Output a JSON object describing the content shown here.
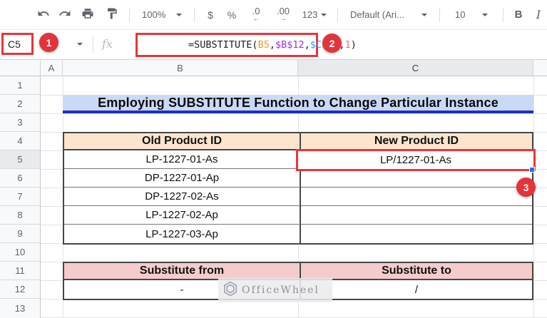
{
  "toolbar": {
    "zoom": "100%",
    "currency": "$",
    "percent": "%",
    "decrease_decimal": ".0",
    "decrease_decimal_arrow": "←",
    "increase_decimal": ".00",
    "increase_decimal_arrow": "→",
    "number_format": "123",
    "font_name": "Default (Ari...",
    "font_size": "10",
    "bold": "B",
    "italic": "I",
    "icons": {
      "undo": "undo-icon",
      "redo": "redo-icon",
      "print": "print-icon",
      "paint_format": "paint-format-icon",
      "dropdown": "chevron-down-icon"
    }
  },
  "formula_bar": {
    "name_box": "C5",
    "fx_label": "fx",
    "formula_full": "=SUBSTITUTE(B5,$B$12,$C$12,1)",
    "formula_tokens": [
      {
        "text": "=SUBSTITUTE(",
        "color": "#202124"
      },
      {
        "text": "B5",
        "color": "#f7981c"
      },
      {
        "text": ",",
        "color": "#202124"
      },
      {
        "text": "$B$12",
        "color": "#9334e6"
      },
      {
        "text": ",",
        "color": "#202124"
      },
      {
        "text": "$C$12",
        "color": "#2aa4f4"
      },
      {
        "text": ",",
        "color": "#202124"
      },
      {
        "text": "1",
        "color": "#ee6e62"
      },
      {
        "text": ")",
        "color": "#202124"
      }
    ]
  },
  "annotations": {
    "step1": "1",
    "step2": "2",
    "step3": "3"
  },
  "grid": {
    "column_letters": [
      "A",
      "B",
      "C"
    ],
    "row_numbers": [
      "1",
      "2",
      "3",
      "4",
      "5",
      "6",
      "7",
      "8",
      "9",
      "10",
      "11",
      "12",
      "13"
    ]
  },
  "sheet": {
    "title": "Employing SUBSTITUTE Function to Change Particular Instance",
    "product_table": {
      "headers": [
        "Old Product ID",
        "New Product ID"
      ],
      "rows": [
        [
          "LP-1227-01-As",
          "LP/1227-01-As"
        ],
        [
          "DP-1227-01-Ap",
          ""
        ],
        [
          "DP-1227-02-As",
          ""
        ],
        [
          "LP-1227-02-Ap",
          ""
        ],
        [
          "LP-1227-03-Ap",
          ""
        ]
      ]
    },
    "substitute_table": {
      "headers": [
        "Substitute from",
        "Substitute to"
      ],
      "rows": [
        [
          "-",
          "/"
        ]
      ]
    },
    "watermark_text": "OfficeWheel"
  },
  "colors": {
    "annotation_red": "#e2343a",
    "highlight_border_red": "#e8363b",
    "selection_handle_blue": "#1a73e8",
    "title_bg": "#c9daf8",
    "title_underline": "#1d2dcb",
    "product_header_bg": "#fce5cd",
    "substitute_header_bg": "#f4cccc",
    "selected_header_bg": "#e8eaed"
  }
}
